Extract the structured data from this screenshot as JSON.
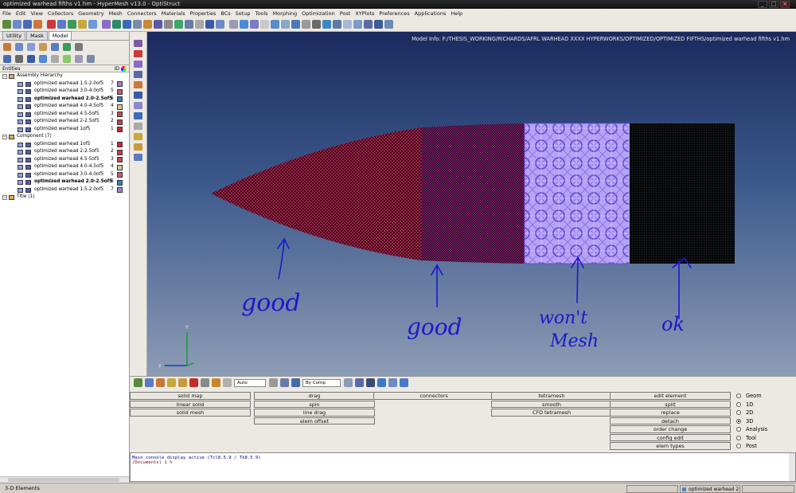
{
  "window": {
    "title": "optimized warhead fifths v1.hm - HyperMesh v13.0 - OptiStruct",
    "controls": [
      "_",
      "□",
      "×"
    ]
  },
  "menu": [
    "File",
    "Edit",
    "View",
    "Collectors",
    "Geometry",
    "Mesh",
    "Connectors",
    "Materials",
    "Properties",
    "BCs",
    "Setup",
    "Tools",
    "Morphing",
    "Optimization",
    "Post",
    "XYPlots",
    "Preferences",
    "Applications",
    "Help"
  ],
  "tabs": [
    "Utility",
    "Mask",
    "Model"
  ],
  "entities": {
    "header": "Entities",
    "id_header": "ID"
  },
  "tree": {
    "assembly": {
      "label": "Assembly Hierarchy",
      "items": [
        {
          "label": "optimized warhead 1.5-2.0of5",
          "id": "7",
          "color": "#9b7fd0",
          "bold": false
        },
        {
          "label": "optimized warhead 3.0-4.0of5",
          "id": "5",
          "color": "#c85a7a",
          "bold": false
        },
        {
          "label": "optimized warhead 2.0-2.5of5",
          "id": "6",
          "color": "#3a7fc0",
          "bold": true
        },
        {
          "label": "optimized warhead 4.0-4.5of5",
          "id": "4",
          "color": "#d8c89c",
          "bold": false
        },
        {
          "label": "optimized warhead 4.5-5of5",
          "id": "3",
          "color": "#c84a4a",
          "bold": false
        },
        {
          "label": "optimized warhead 2-2.5of5",
          "id": "2",
          "color": "#c83a5a",
          "bold": false
        },
        {
          "label": "optimized warhead 1of5",
          "id": "1",
          "color": "#c8283a",
          "bold": false
        }
      ]
    },
    "component": {
      "label": "Component (7)",
      "items": [
        {
          "label": "optimized warhead 1of5",
          "id": "1",
          "color": "#c8283a",
          "bold": false
        },
        {
          "label": "optimized warhead 2-2.5of5",
          "id": "2",
          "color": "#c83a5a",
          "bold": false
        },
        {
          "label": "optimized warhead 4.5-5of5",
          "id": "3",
          "color": "#c84a4a",
          "bold": false
        },
        {
          "label": "optimized warhead 4.0-4.5of5",
          "id": "4",
          "color": "#d8c89c",
          "bold": false
        },
        {
          "label": "optimized warhead 3.0-4.0of5",
          "id": "5",
          "color": "#c85a7a",
          "bold": false
        },
        {
          "label": "optimized warhead 2.0-2.5of5",
          "id": "6",
          "color": "#3a7fc0",
          "bold": true
        },
        {
          "label": "optimized warhead 1.5-2.0of5",
          "id": "7",
          "color": "#9b7fd0",
          "bold": false
        }
      ]
    },
    "title": {
      "label": "Title (1)"
    }
  },
  "viewport": {
    "model_info": "Model Info: F:/THESIS_WORKING/RICHARDS/AFRL WARHEAD XXXX HYPERWORKS/OPTIMIZED/OPTIMIZED FIFTHS/optimized warhead fifths v1.hm",
    "annotations": [
      "good",
      "good",
      "won't",
      "Mesh",
      "ok"
    ],
    "axes": {
      "x": "x",
      "y": "Y",
      "z": "z"
    },
    "colors": {
      "section1": "#c4204a",
      "section2": "#a0247a",
      "section3": "#9a78e8",
      "section4": "#111111",
      "ink": "#1a1acc"
    }
  },
  "panel_toolbar": {
    "render_mode": "Auto",
    "color_mode": "By Comp"
  },
  "menu_panel": {
    "col1": [
      "solid map",
      "linear solid",
      "solid mesh"
    ],
    "col2": [
      "drag",
      "spin",
      "line drag",
      "elem offset"
    ],
    "col3": [
      "connectors"
    ],
    "col4": [
      "tetramesh",
      "smooth",
      "CFD tetramesh"
    ],
    "col5": [
      "edit element",
      "split",
      "replace",
      "detach",
      "order change",
      "config edit",
      "elem types"
    ],
    "radios": [
      {
        "label": "Geom",
        "selected": false
      },
      {
        "label": "1D",
        "selected": false
      },
      {
        "label": "2D",
        "selected": false
      },
      {
        "label": "3D",
        "selected": true
      },
      {
        "label": "Analysis",
        "selected": false
      },
      {
        "label": "Tool",
        "selected": false
      },
      {
        "label": "Post",
        "selected": false
      }
    ]
  },
  "console": {
    "line1": "Main console display active (Tcl8.5.9 / Tk8.5.9)",
    "line2": "(Documents) 1 %"
  },
  "status": {
    "left": "3-D Elements",
    "component": "optimized warhead 2"
  }
}
